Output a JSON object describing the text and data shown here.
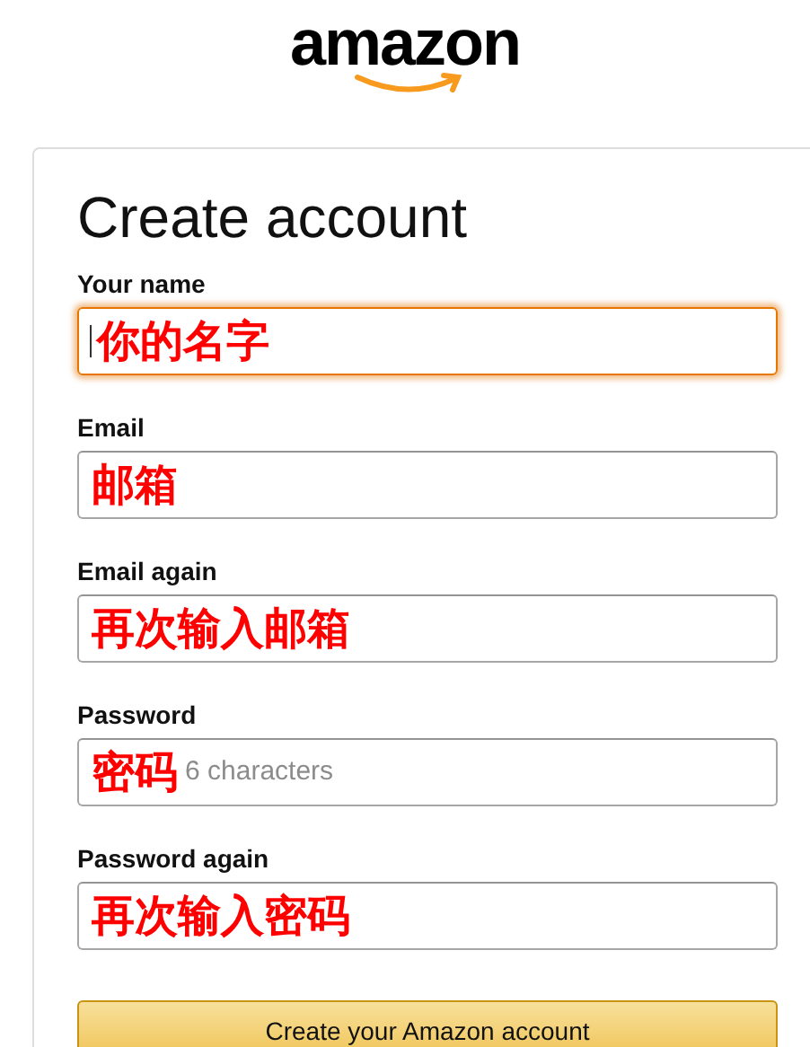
{
  "logo": {
    "text": "amazon"
  },
  "title": "Create account",
  "fields": [
    {
      "label": "Your name",
      "annotation": "你的名字",
      "focused": true
    },
    {
      "label": "Email",
      "annotation": "邮箱",
      "focused": false
    },
    {
      "label": "Email again",
      "annotation": "再次输入邮箱",
      "focused": false
    },
    {
      "label": "Password",
      "annotation": "密码",
      "placeholder": "6 characters",
      "focused": false
    },
    {
      "label": "Password again",
      "annotation": "再次输入密码",
      "focused": false
    }
  ],
  "submit": "Create your Amazon account"
}
